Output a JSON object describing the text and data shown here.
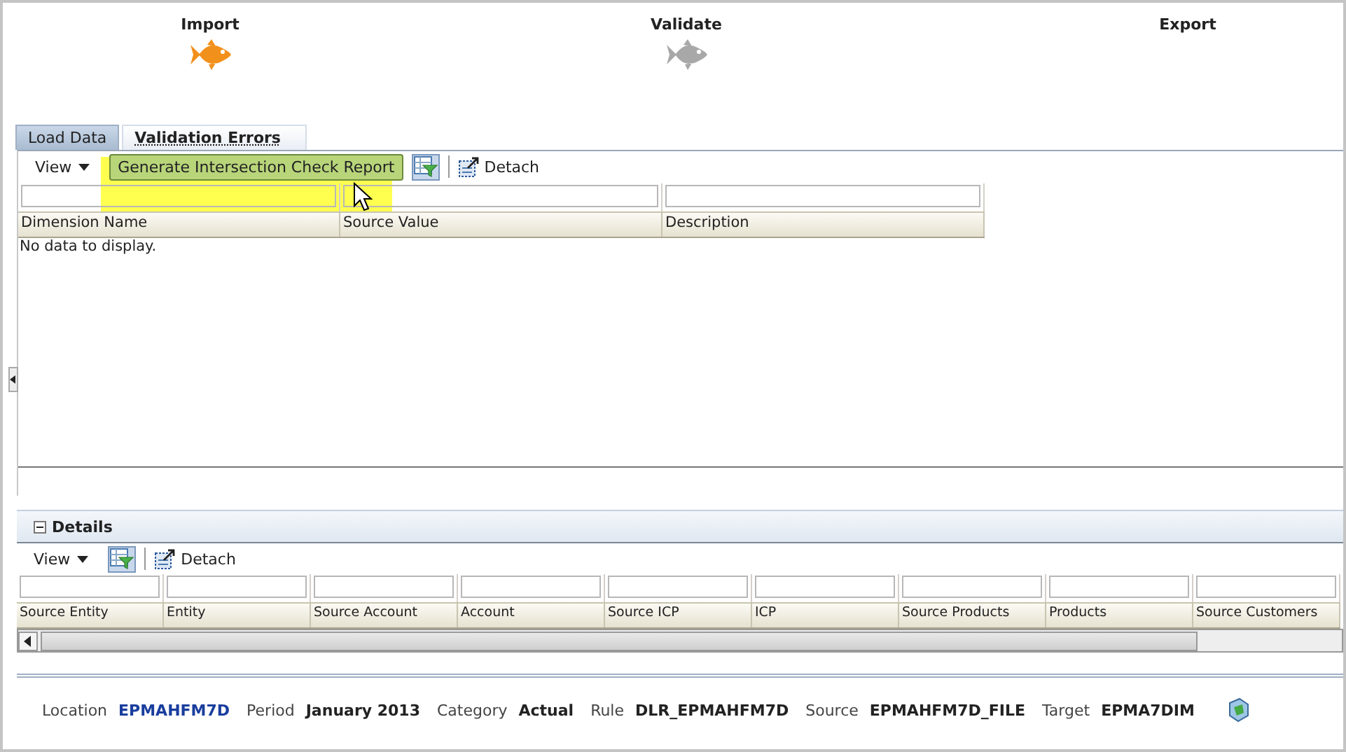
{
  "train": [
    {
      "label": "Import",
      "kind": "done"
    },
    {
      "label": "Validate",
      "kind": "pending"
    },
    {
      "label": "Export",
      "kind": "blank"
    }
  ],
  "tabs": [
    {
      "label": "Load Data",
      "selected": false
    },
    {
      "label": "Validation Errors",
      "selected": true
    }
  ],
  "toolbar": {
    "view": "View",
    "report_button": "Generate Intersection Check Report",
    "detach": "Detach"
  },
  "grid": {
    "columns": [
      "Dimension Name",
      "Source Value",
      "Description"
    ],
    "empty_message": "No data to display."
  },
  "details": {
    "title": "Details",
    "expanded": true,
    "view": "View",
    "detach": "Detach",
    "columns": [
      "Source Entity",
      "Entity",
      "Source Account",
      "Account",
      "Source ICP",
      "ICP",
      "Source Products",
      "Products",
      "Source Customers"
    ]
  },
  "footer": [
    {
      "label": "Location",
      "value": "EPMAHFM7D",
      "link": true
    },
    {
      "label": "Period",
      "value": "January 2013",
      "link": false
    },
    {
      "label": "Category",
      "value": "Actual",
      "link": false
    },
    {
      "label": "Rule",
      "value": "DLR_EPMAHFM7D",
      "link": false
    },
    {
      "label": "Source",
      "value": "EPMAHFM7D_FILE",
      "link": false
    },
    {
      "label": "Target",
      "value": "EPMA7DIM",
      "link": false
    }
  ]
}
